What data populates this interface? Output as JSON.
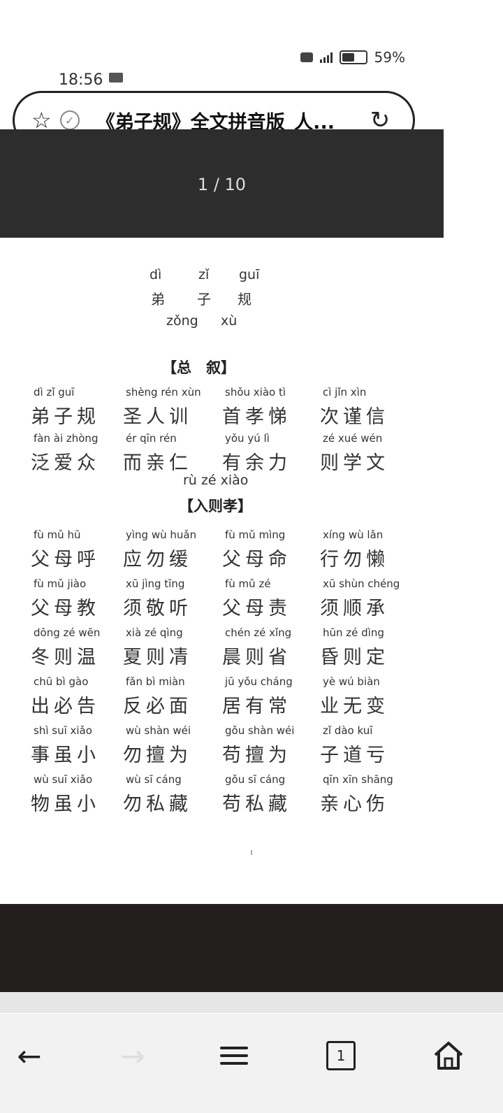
{
  "status_bar": {
    "time": "18:56",
    "battery_percent": "59%",
    "battery_level": 0.59
  },
  "address_bar": {
    "title": "《弟子规》全文拼音版_人..."
  },
  "pdf": {
    "page_counter": "1 / 10"
  },
  "document": {
    "title_pinyin": [
      "dì",
      "zǐ",
      "guī"
    ],
    "title_hanzi": [
      "弟",
      "子",
      "规"
    ],
    "subtitle_pinyin": [
      "zǒng",
      "xù"
    ],
    "section1": "【总　叙】",
    "section2_pinyin": "rù zé xiào",
    "section2": "【入则孝】",
    "lines": [
      {
        "py": [
          "dì zǐ guī",
          "shèng rén xùn",
          "shǒu xiào tì",
          "cì jǐn xìn"
        ],
        "hz": [
          "弟子规",
          "圣人训",
          "首孝悌",
          "次谨信"
        ]
      },
      {
        "py": [
          "fàn ài zhòng",
          "ér qīn rén",
          "yǒu yú lì",
          "zé xué wén"
        ],
        "hz": [
          "泛爱众",
          "而亲仁",
          "有余力",
          "则学文"
        ]
      },
      {
        "py": [
          "fù mǔ hū",
          "yìng wù huǎn",
          "fù mǔ mìng",
          "xíng wù lǎn"
        ],
        "hz": [
          "父母呼",
          "应勿缓",
          "父母命",
          "行勿懒"
        ]
      },
      {
        "py": [
          "fù mǔ jiào",
          "xū jìng tīng",
          "fù mǔ zé",
          "xū shùn chéng"
        ],
        "hz": [
          "父母教",
          "须敬听",
          "父母责",
          "须顺承"
        ]
      },
      {
        "py": [
          "dōng zé wēn",
          "xià zé qìng",
          "chén zé xǐng",
          "hūn zé dìng"
        ],
        "hz": [
          "冬则温",
          "夏则凊",
          "晨则省",
          "昏则定"
        ]
      },
      {
        "py": [
          "chū bì gào",
          "fǎn bì miàn",
          "jū yǒu cháng",
          "yè wú biàn"
        ],
        "hz": [
          "出必告",
          "反必面",
          "居有常",
          "业无变"
        ]
      },
      {
        "py": [
          "shì suī xiǎo",
          "wù shàn wéi",
          "gǒu shàn wéi",
          "zǐ dào kuī"
        ],
        "hz": [
          "事虽小",
          "勿擅为",
          "苟擅为",
          "子道亏"
        ]
      },
      {
        "py": [
          "wù suī xiǎo",
          "wù sī cáng",
          "gǒu sī cáng",
          "qīn xīn shāng"
        ],
        "hz": [
          "物虽小",
          "勿私藏",
          "苟私藏",
          "亲心伤"
        ]
      }
    ]
  },
  "nav": {
    "back": "←",
    "forward": "→",
    "tab_count": "1"
  }
}
